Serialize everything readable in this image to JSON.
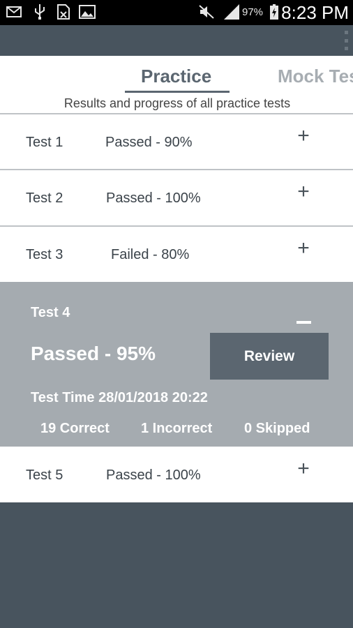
{
  "status_bar": {
    "battery": "97%",
    "time": "8:23 PM"
  },
  "tabs": [
    {
      "label": "Practice",
      "active": true
    },
    {
      "label": "Mock Tests",
      "active": false
    }
  ],
  "subtitle": "Results and progress of all practice tests",
  "tests": [
    {
      "name": "Test 1",
      "result": "Passed - 90%"
    },
    {
      "name": "Test 2",
      "result": "Passed - 100%"
    },
    {
      "name": "Test 3",
      "result": "Failed - 80%"
    },
    {
      "name": "Test 4",
      "result": "Passed - 95%"
    },
    {
      "name": "Test 5",
      "result": "Passed - 100%"
    }
  ],
  "expanded": {
    "review_label": "Review",
    "test_time": "Test Time 28/01/2018 20:22",
    "correct": "19 Correct",
    "incorrect": "1 Incorrect",
    "skipped": "0 Skipped"
  },
  "colors": {
    "primary": "#48545e",
    "accent": "#5b6670",
    "expanded_bg": "#a5abb0"
  }
}
